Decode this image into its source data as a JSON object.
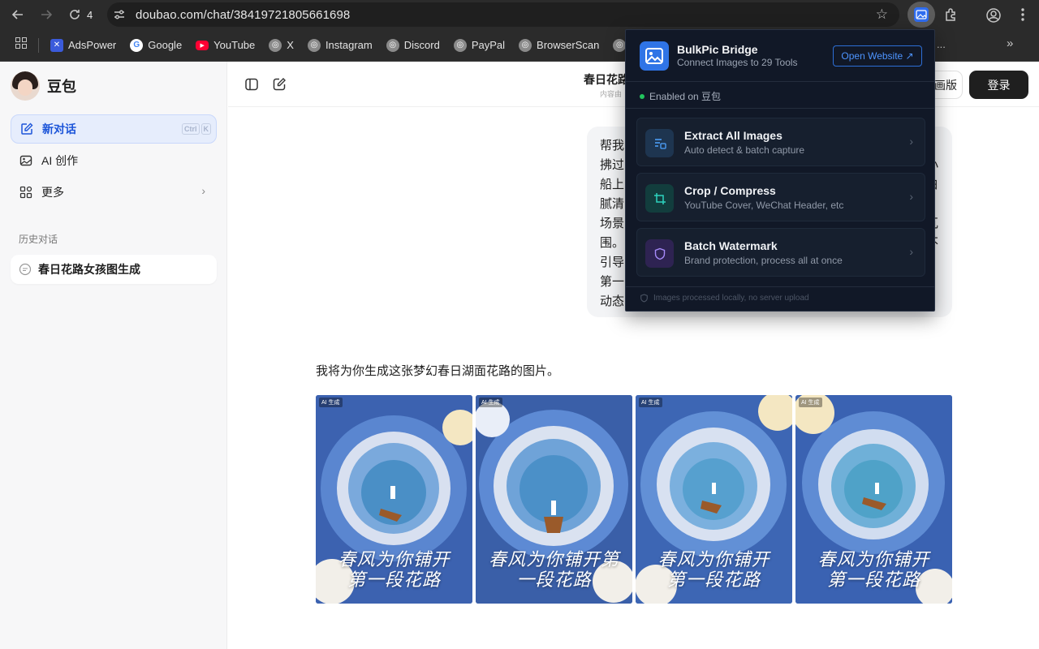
{
  "browser": {
    "tab_count": "4",
    "url": "doubao.com/chat/38419721805661698",
    "bookmarks": [
      "AdsPower",
      "Google",
      "YouTube",
      "X",
      "Instagram",
      "Discord",
      "PayPal",
      "BrowserScan",
      "Sc"
    ],
    "overflow_label": "..."
  },
  "sidebar": {
    "brand_name": "豆包",
    "new_chat_label": "新对话",
    "shortcut_keys": [
      "Ctrl",
      "K"
    ],
    "ai_create_label": "AI 创作",
    "more_label": "更多",
    "history_title": "历史对话",
    "history_items": [
      "春日花路女孩图生成"
    ]
  },
  "topbar": {
    "chat_title": "春日花路",
    "chat_subtitle": "内容由",
    "download_label": "画版",
    "login_label": "登录"
  },
  "user_message": {
    "lines": [
      "帮我",
      "拂过",
      "船上",
      "腻清",
      "场景",
      "围。",
      "引导",
      "第一",
      "动态"
    ],
    "right_fragments": [
      "，",
      "小",
      "白",
      "",
      "瓦",
      "不",
      "",
      "",
      ""
    ]
  },
  "assistant": {
    "reply": "我将为你生成这张梦幻春日湖面花路的图片。",
    "images": [
      {
        "tag": "AI 生成",
        "line1": "春风为你铺开",
        "line2": "第一段花路"
      },
      {
        "tag": "AI 生成",
        "line1": "春风为你铺开第",
        "line2": "一段花路"
      },
      {
        "tag": "AI 生成",
        "line1": "春风为你铺开",
        "line2": "第一段花路"
      },
      {
        "tag": "AI 生成",
        "line1": "春风为你铺开",
        "line2": "第一段花路"
      }
    ]
  },
  "popup": {
    "title": "BulkPic Bridge",
    "subtitle": "Connect Images to 29 Tools",
    "open_website": "Open Website ↗",
    "enabled_text": "Enabled on 豆包",
    "cards": [
      {
        "title": "Extract All Images",
        "subtitle": "Auto detect & batch capture",
        "icon": "images-icon",
        "color": "#3b82f6"
      },
      {
        "title": "Crop / Compress",
        "subtitle": "YouTube Cover, WeChat Header, etc",
        "icon": "crop-icon",
        "color": "#14b8a6"
      },
      {
        "title": "Batch Watermark",
        "subtitle": "Brand protection, process all at once",
        "icon": "shield-icon",
        "color": "#8b5cf6"
      }
    ],
    "footer": "Images processed locally, no server upload"
  }
}
